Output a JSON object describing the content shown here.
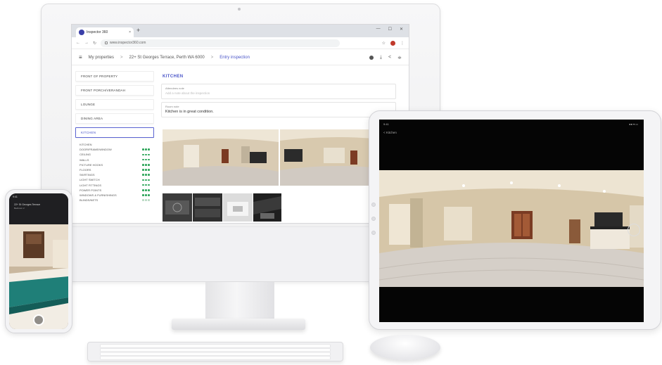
{
  "browser": {
    "tab_title": "Inspector 360",
    "new_tab_glyph": "+",
    "close_glyph": "×",
    "window_controls": [
      "—",
      "☐",
      "✕"
    ],
    "url": "www.inspector360.com"
  },
  "header": {
    "breadcrumbs": [
      "My properties",
      "22+ St Georges Terrace, Perth WA 6000",
      "Entry inspection"
    ],
    "separator": ">",
    "actions_icons": [
      "info-icon",
      "download-icon",
      "share-icon",
      "filter-icon"
    ]
  },
  "sidebar": {
    "rooms": [
      "FRONT OF PROPERTY",
      "FRONT PORCH/VERANDAH",
      "LOUNGE",
      "DINING AREA",
      "KITCHEN"
    ],
    "selected_room": "KITCHEN",
    "items": [
      {
        "label": "KITCHEN",
        "rated": false
      },
      {
        "label": "DOOR/FRAME/WINDOW",
        "rated": true
      },
      {
        "label": "CEILING",
        "rated": true
      },
      {
        "label": "WALLS",
        "rated": true
      },
      {
        "label": "PICTURE HOOKS",
        "rated": true
      },
      {
        "label": "FLOORS",
        "rated": true
      },
      {
        "label": "SKIRTINGS",
        "rated": true
      },
      {
        "label": "LIGHT SWITCH",
        "rated": true
      },
      {
        "label": "LIGHT FITTINGS",
        "rated": true
      },
      {
        "label": "POWER POINTS",
        "rated": true
      },
      {
        "label": "WINDOWS & FURNISHINGS",
        "rated": true
      },
      {
        "label": "BLINDS/NETS",
        "rated": "light"
      }
    ]
  },
  "main": {
    "room_title": "KITCHEN",
    "fields": [
      {
        "label": "Attendees note",
        "value": "Add a note about the inspection",
        "placeholder": true
      },
      {
        "label": "Room note",
        "value": "Kitchen is in great condition.",
        "placeholder": false
      }
    ]
  },
  "phone": {
    "time": "9:41",
    "title": "22+ St Georges Terrace",
    "subtitle": "Bedroom 2"
  },
  "ipad": {
    "time": "9:41",
    "status_right": "●● ▾ ▭",
    "back_label": "< Kitchen"
  },
  "colors": {
    "accent": "#4a55c8",
    "rating_green": "#2fa65b"
  }
}
